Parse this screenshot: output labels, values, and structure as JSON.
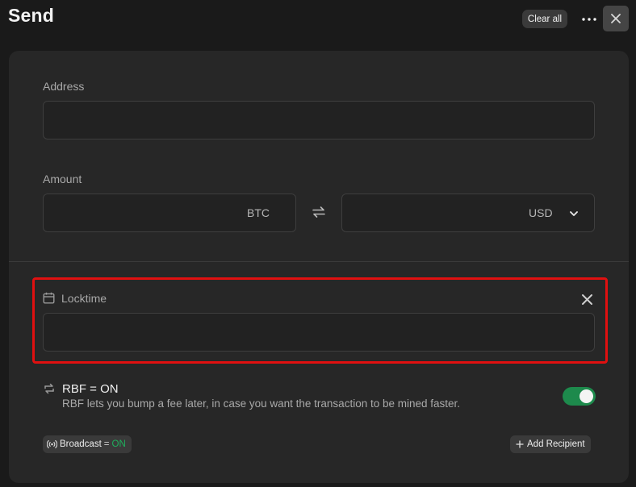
{
  "header": {
    "title": "Send",
    "clear_all_label": "Clear all",
    "more_icon": "more-horizontal-icon",
    "close_icon": "close-icon"
  },
  "form": {
    "address": {
      "label": "Address",
      "value": ""
    },
    "amount": {
      "label": "Amount",
      "btc_value": "",
      "btc_unit": "BTC",
      "swap_icon": "swap-arrows-icon",
      "fiat_value": "",
      "fiat_unit": "USD",
      "fiat_dropdown_icon": "chevron-down-icon"
    },
    "locktime": {
      "label": "Locktime",
      "icon": "calendar-icon",
      "value": "",
      "remove_icon": "close-icon"
    },
    "rbf": {
      "title": "RBF = ON",
      "description": "RBF lets you bump a fee later, in case you want the transaction to be mined faster.",
      "icon": "repeat-arrows-icon",
      "enabled": true
    }
  },
  "footer": {
    "broadcast": {
      "label": "Broadcast",
      "eq": "=",
      "state": "ON",
      "icon": "broadcast-icon"
    },
    "add_recipient_label": "Add Recipient",
    "add_icon": "plus-icon"
  },
  "colors": {
    "background": "#1a1a1a",
    "panel": "#272727",
    "highlight": "#e01010",
    "toggle_on": "#1d8a4c",
    "on_text": "#1fae5c"
  }
}
